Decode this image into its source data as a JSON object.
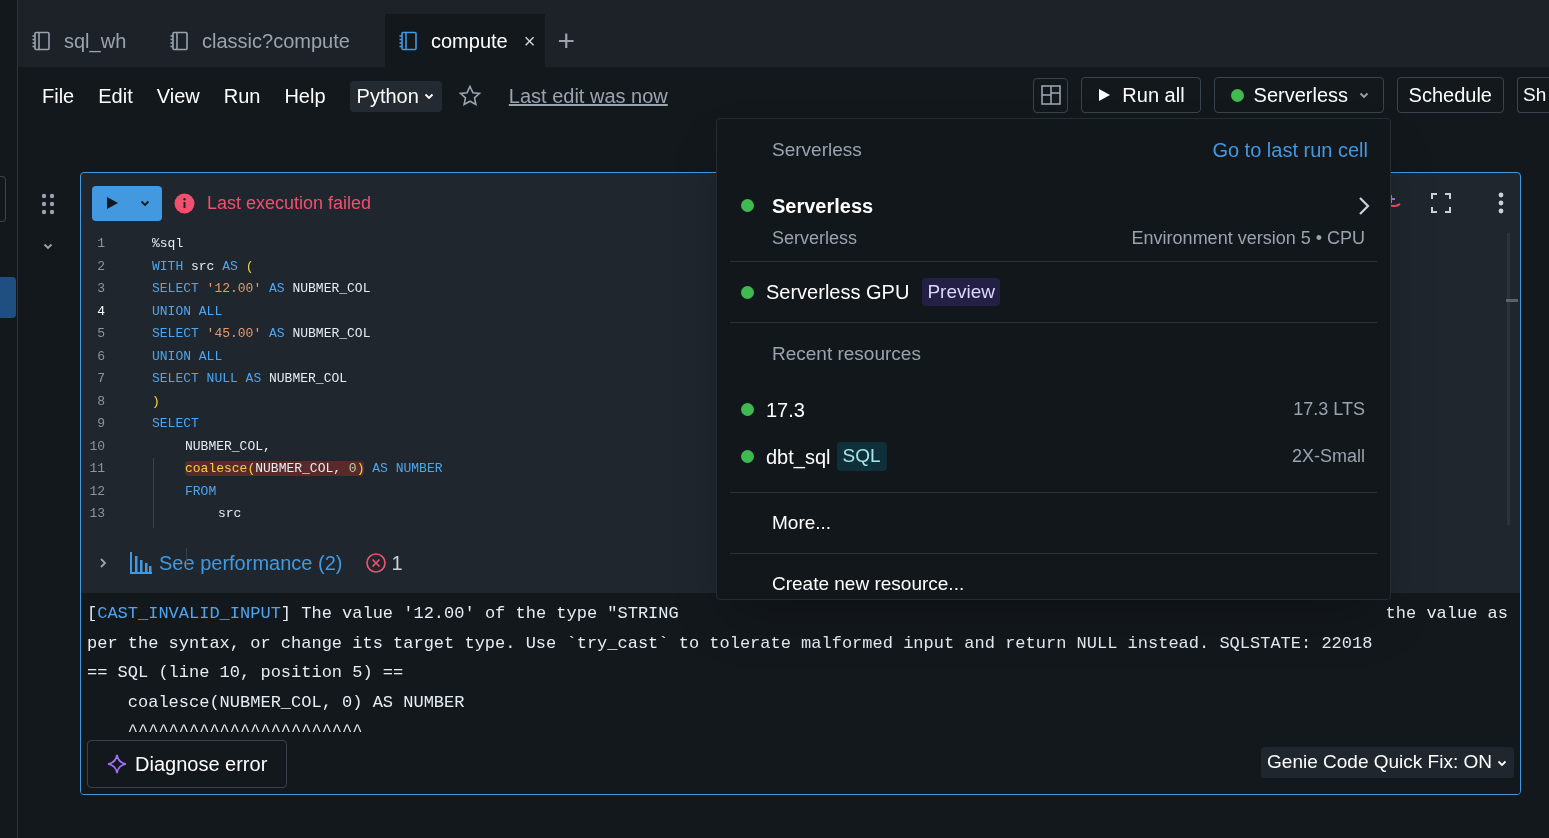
{
  "tabs": [
    {
      "label": "sql_wh",
      "selected": false
    },
    {
      "label": "classic?compute",
      "selected": false
    },
    {
      "label": "compute",
      "selected": true,
      "close": "×"
    }
  ],
  "new_tab": "+",
  "menu_bar": [
    "File",
    "Edit",
    "View",
    "Run",
    "Help"
  ],
  "language": "Python",
  "last_edit": "Last edit was now",
  "toolbar": {
    "run_all": "Run all",
    "compute": {
      "label": "Serverless"
    },
    "schedule": "Schedule",
    "share": "Sh"
  },
  "cell": {
    "status": "Last execution failed",
    "code": [
      {
        "number": "1",
        "active": false,
        "tokens": [
          {
            "kind": "plain",
            "text": "%sql"
          }
        ]
      },
      {
        "number": "2",
        "active": false,
        "tokens": [
          {
            "kind": "keyword",
            "text": "WITH"
          },
          {
            "kind": "plain",
            "text": " src "
          },
          {
            "kind": "keyword",
            "text": "AS"
          },
          {
            "kind": "paren",
            "text": " ("
          }
        ]
      },
      {
        "number": "3",
        "active": false,
        "tokens": [
          {
            "kind": "keyword",
            "text": "SELECT"
          },
          {
            "kind": "string",
            "text": " '12.00'"
          },
          {
            "kind": "keyword",
            "text": " AS"
          },
          {
            "kind": "plain",
            "text": " NUBMER_COL"
          }
        ]
      },
      {
        "number": "4",
        "active": true,
        "tokens": [
          {
            "kind": "keyword",
            "text": "UNION ALL"
          }
        ]
      },
      {
        "number": "5",
        "active": false,
        "tokens": [
          {
            "kind": "keyword",
            "text": "SELECT"
          },
          {
            "kind": "string",
            "text": " '45.00'"
          },
          {
            "kind": "keyword",
            "text": " AS"
          },
          {
            "kind": "plain",
            "text": " NUBMER_COL"
          }
        ]
      },
      {
        "number": "6",
        "active": false,
        "tokens": [
          {
            "kind": "keyword",
            "text": "UNION ALL"
          }
        ]
      },
      {
        "number": "7",
        "active": false,
        "tokens": [
          {
            "kind": "keyword",
            "text": "SELECT NULL AS"
          },
          {
            "kind": "plain",
            "text": " NUBMER_COL"
          }
        ]
      },
      {
        "number": "8",
        "active": false,
        "tokens": [
          {
            "kind": "paren",
            "text": ")"
          }
        ]
      },
      {
        "number": "9",
        "active": false,
        "tokens": [
          {
            "kind": "keyword",
            "text": "SELECT"
          }
        ],
        "children": [
          {
            "number": "10",
            "active": false,
            "tokens": [
              {
                "kind": "plain",
                "text": "NUBMER_COL,"
              }
            ]
          },
          {
            "number": "11",
            "active": false,
            "tokens": [
              {
                "kind": "function",
                "text": "coalesce",
                "error": true
              },
              {
                "kind": "paren",
                "text": "(",
                "error": true
              },
              {
                "kind": "plain",
                "text": "NUBMER_COL, ",
                "error": true
              },
              {
                "kind": "number",
                "text": "0",
                "error": true
              },
              {
                "kind": "paren",
                "text": ")",
                "error": true
              },
              {
                "kind": "keyword",
                "text": " AS NUMBER"
              }
            ]
          },
          {
            "number": "12",
            "active": false,
            "tokens": [
              {
                "kind": "keyword",
                "text": "FROM"
              }
            ],
            "children": [
              {
                "number": "13",
                "active": false,
                "tokens": [
                  {
                    "kind": "plain",
                    "text": "src"
                  }
                ]
              }
            ]
          }
        ]
      }
    ],
    "performance": "See performance (2)",
    "error_count": "1",
    "error_output": {
      "line1_left": {
        "open": "[",
        "code": "CAST_INVALID_INPUT",
        "text": "] The value '12.00' of the type \"STRING"
      },
      "line1_right": "the value as",
      "lines": [
        "per the syntax, or change its target type. Use `try_cast` to tolerate malformed input and return NULL instead. SQLSTATE: 22018",
        "== SQL (line 10, position 5) ==",
        "    coalesce(NUBMER_COL, 0) AS NUMBER",
        "    ^^^^^^^^^^^^^^^^^^^^^^^"
      ]
    },
    "diagnose": "Diagnose error",
    "quick_fix": "Genie Code Quick Fix: ON"
  },
  "compute_menu": {
    "header": "Serverless",
    "go_to_last": "Go to last run cell",
    "current": {
      "name": "Serverless",
      "subtitle": "Serverless",
      "detail": "Environment version 5 • CPU",
      "color": "#3fb950"
    },
    "gpu": {
      "name": "Serverless GPU",
      "badge": "Preview",
      "color": "#3fb950"
    },
    "recent_header": "Recent resources",
    "recent": [
      {
        "name": "17.3",
        "detail": "17.3 LTS",
        "color": "#3fb950"
      },
      {
        "name": "dbt_sql",
        "badge": "SQL",
        "detail": "2X-Small",
        "color": "#3fb950"
      }
    ],
    "more": "More...",
    "create": "Create new resource..."
  }
}
